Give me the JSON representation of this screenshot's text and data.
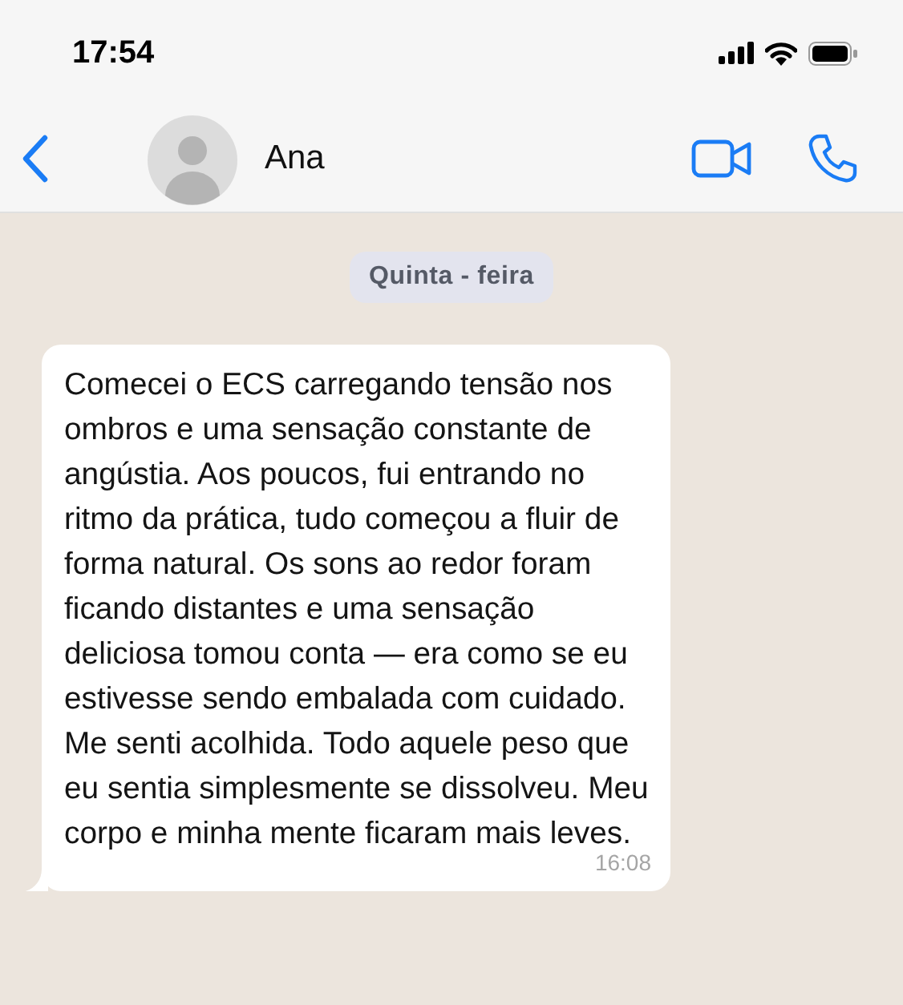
{
  "status_bar": {
    "time": "17:54"
  },
  "header": {
    "contact_name": "Ana"
  },
  "date_label": "Quinta - feira",
  "messages": [
    {
      "text": "Comecei o ECS carregando tensão nos ombros e uma sensação constante de angústia. Aos poucos, fui entrando no ritmo da prática, tudo começou a fluir de forma natural. Os sons ao redor foram ficando distantes e uma sensação deliciosa tomou conta — era como se eu estivesse sendo embalada com cuidado. Me senti acolhida. Todo aquele peso que eu sentia simplesmente se dissolveu. Meu corpo e minha mente ficaram mais leves.",
      "time": "16:08"
    }
  ]
}
